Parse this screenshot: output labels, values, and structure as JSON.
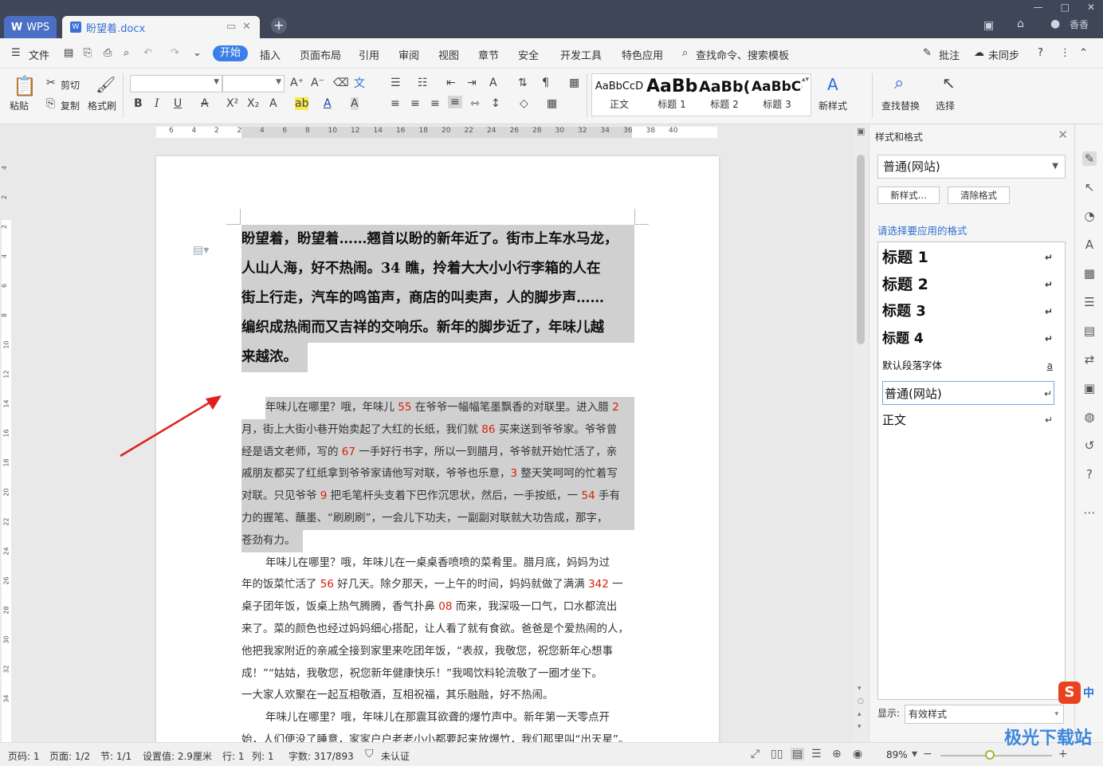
{
  "titlebar": {
    "app_tab": "WPS",
    "doc_tab": "盼望着.docx",
    "new_tab": "+",
    "user": "香香"
  },
  "menu": {
    "file": "文件",
    "start": "开始",
    "insert": "插入",
    "layout": "页面布局",
    "references": "引用",
    "review": "审阅",
    "view": "视图",
    "chapter": "章节",
    "security": "安全",
    "devtools": "开发工具",
    "special": "特色应用",
    "search": "查找命令、搜索模板",
    "comment": "批注",
    "sync": "未同步"
  },
  "ribbon": {
    "paste": "粘贴",
    "cut": "剪切",
    "copy": "复制",
    "format_painter": "格式刷",
    "new_style": "新样式",
    "find_replace": "查找替换",
    "select": "选择",
    "styles": [
      {
        "sample": "AaBbCcD",
        "name": "正文"
      },
      {
        "sample": "AaBb",
        "name": "标题 1"
      },
      {
        "sample": "AaBb(",
        "name": "标题 2"
      },
      {
        "sample": "AaBbC(",
        "name": "标题 3"
      }
    ]
  },
  "ruler": {
    "ticks": [
      "6",
      "4",
      "2",
      "2",
      "4",
      "6",
      "8",
      "10",
      "12",
      "14",
      "16",
      "18",
      "20",
      "22",
      "24",
      "26",
      "28",
      "30",
      "32",
      "34",
      "36",
      "38",
      "40"
    ],
    "vticks": [
      "4",
      "2",
      "2",
      "4",
      "6",
      "8",
      "10",
      "12",
      "14",
      "16",
      "18",
      "20",
      "22",
      "24",
      "26",
      "28",
      "30",
      "32",
      "34"
    ]
  },
  "document": {
    "heading_lines": [
      "盼望着，盼望着……翘首以盼的新年近了。街市上车水马龙，",
      "人山人海，好不热闹。34 瞧，拎着大大小小行李箱的人在",
      "街上行走，汽车的鸣笛声，商店的叫卖声，人的脚步声……",
      "编织成热闹而又吉祥的交响乐。新年的脚步近了，年味儿越",
      "来越浓。"
    ],
    "p1": {
      "l1a": "年味儿在哪里？哦，年味儿 ",
      "n1": "55",
      "l1b": " 在爷爷一幅幅笔墨飘香的对联里。进入腊 ",
      "n2": "2",
      "l2a": "月，街上大街小巷开始卖起了大红的长纸，我们就 ",
      "n3": "86",
      "l2b": " 买来送到爷爷家。爷爷曾",
      "l3a": "经是语文老师，写的 ",
      "n4": "67",
      "l3b": " 一手好行书字，所以一到腊月，爷爷就开始忙活了，亲",
      "l4a": "戚朋友都买了红纸拿到爷爷家请他写对联，爷爷也乐意，",
      "n5": "3",
      "l4b": " 整天笑呵呵的忙着写",
      "l5a": "对联。只见爷爷 ",
      "n6": "9",
      "l5b": " 把毛笔杆头支着下巴作沉思状，然后，一手按纸，一 ",
      "n7": "54",
      "l5c": " 手有",
      "l6": "力的握笔、蘸墨、“刷刷刷”，一会儿下功夫，一副副对联就大功告成，那字，",
      "l7": "苍劲有力。"
    },
    "p2": {
      "l1": "年味儿在哪里？哦，年味儿在一桌桌香喷喷的菜肴里。腊月底，妈妈为过",
      "l2a": "年的饭菜忙活了 ",
      "n1": "56",
      "l2b": " 好几天。除夕那天，一上午的时间，妈妈就做了满满 ",
      "n2": "342",
      "l2c": " 一",
      "l3a": "桌子团年饭，饭桌上热气腾腾，香气扑鼻 ",
      "n3": "08",
      "l3b": " 而来，我深吸一口气，口水都流出",
      "l4": "来了。菜的颜色也经过妈妈细心搭配，让人看了就有食欲。爸爸是个爱热闹的人，",
      "l5": "他把我家附近的亲戚全接到家里来吃团年饭，“表叔，我敬您，祝您新年心想事",
      "l6": "成！”“姑姑，我敬您，祝您新年健康快乐！”我喝饮料轮流敬了一圈才坐下。",
      "l7": "一大家人欢聚在一起互相敬酒，互相祝福，其乐融融，好不热闹。"
    },
    "p3": {
      "l1": "年味儿在哪里？哦，年味儿在那震耳欲聋的爆竹声中。新年第一天零点开",
      "l2": "始，人们便没了睡意，家家户户老老小小都要起来放爆竹，我们那里叫“出天星”。"
    }
  },
  "panel": {
    "title": "样式和格式",
    "current_style": "普通(网站)",
    "new_style_btn": "新样式...",
    "clear_btn": "清除格式",
    "apply_label": "请选择要应用的格式",
    "items": [
      {
        "label": "标题  1",
        "mark": "↵"
      },
      {
        "label": "标题  2",
        "mark": "↵"
      },
      {
        "label": "标题  3",
        "mark": "↵"
      },
      {
        "label": "标题  4",
        "mark": "↵"
      },
      {
        "label": "默认段落字体",
        "mark": "a"
      },
      {
        "label": "普通(网站)",
        "mark": "↵"
      },
      {
        "label": "正文",
        "mark": "↵"
      }
    ],
    "show_label": "显示:",
    "show_value": "有效样式"
  },
  "status": {
    "page_num": "页码: 1",
    "page_of": "页面: 1/2",
    "section": "节: 1/1",
    "setting": "设置值: 2.9厘米",
    "row": "行: 1",
    "col": "列: 1",
    "words": "字数: 317/893",
    "cert": "未认证",
    "zoom": "89%"
  },
  "watermark": "极光下载站",
  "ime": {
    "logo": "S",
    "lang": "中"
  }
}
